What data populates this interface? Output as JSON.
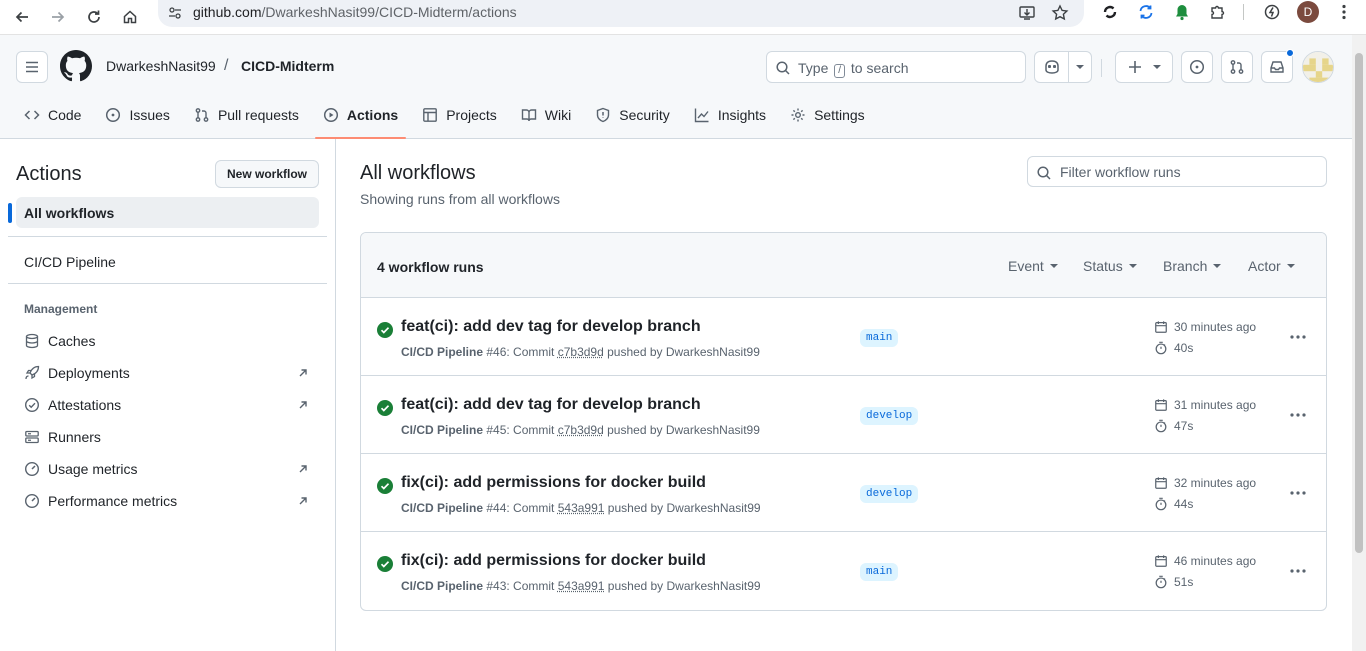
{
  "browser": {
    "url_host": "github.com",
    "url_path": "/DwarkeshNasit99/CICD-Midterm/actions",
    "profile_initial": "D"
  },
  "header": {
    "owner": "DwarkeshNasit99",
    "separator": "/",
    "repo": "CICD-Midterm",
    "search_pre": "Type",
    "search_key": "/",
    "search_post": "to search"
  },
  "tabs": [
    {
      "label": "Code",
      "icon": "code-icon"
    },
    {
      "label": "Issues",
      "icon": "issue-icon"
    },
    {
      "label": "Pull requests",
      "icon": "pull-request-icon"
    },
    {
      "label": "Actions",
      "icon": "play-icon",
      "active": true
    },
    {
      "label": "Projects",
      "icon": "table-icon"
    },
    {
      "label": "Wiki",
      "icon": "book-icon"
    },
    {
      "label": "Security",
      "icon": "shield-icon"
    },
    {
      "label": "Insights",
      "icon": "graph-icon"
    },
    {
      "label": "Settings",
      "icon": "gear-icon"
    }
  ],
  "sidebar": {
    "title": "Actions",
    "new_workflow": "New workflow",
    "all_workflows": "All workflows",
    "workflows": [
      "CI/CD Pipeline"
    ],
    "management_label": "Management",
    "management": [
      {
        "label": "Caches",
        "icon": "database-icon",
        "external": false
      },
      {
        "label": "Deployments",
        "icon": "rocket-icon",
        "external": true
      },
      {
        "label": "Attestations",
        "icon": "verified-icon",
        "external": true
      },
      {
        "label": "Runners",
        "icon": "server-icon",
        "external": false
      },
      {
        "label": "Usage metrics",
        "icon": "meter-icon",
        "external": true
      },
      {
        "label": "Performance metrics",
        "icon": "meter-icon",
        "external": true
      }
    ]
  },
  "main": {
    "title": "All workflows",
    "subtitle": "Showing runs from all workflows",
    "filter_placeholder": "Filter workflow runs",
    "runs_count": "4 workflow runs",
    "filters": [
      "Event",
      "Status",
      "Branch",
      "Actor"
    ],
    "runs": [
      {
        "title": "feat(ci): add dev tag for develop branch",
        "workflow": "CI/CD Pipeline",
        "number": "#46",
        "commit_label": ": Commit",
        "sha": "c7b3d9d",
        "pushed_by": "pushed by DwarkeshNasit99",
        "branch": "main",
        "when": "30 minutes ago",
        "duration": "40s",
        "status": "success"
      },
      {
        "title": "feat(ci): add dev tag for develop branch",
        "workflow": "CI/CD Pipeline",
        "number": "#45",
        "commit_label": ": Commit",
        "sha": "c7b3d9d",
        "pushed_by": "pushed by DwarkeshNasit99",
        "branch": "develop",
        "when": "31 minutes ago",
        "duration": "47s",
        "status": "success"
      },
      {
        "title": "fix(ci): add permissions for docker build",
        "workflow": "CI/CD Pipeline",
        "number": "#44",
        "commit_label": ": Commit",
        "sha": "543a991",
        "pushed_by": "pushed by DwarkeshNasit99",
        "branch": "develop",
        "when": "32 minutes ago",
        "duration": "44s",
        "status": "success"
      },
      {
        "title": "fix(ci): add permissions for docker build",
        "workflow": "CI/CD Pipeline",
        "number": "#43",
        "commit_label": ": Commit",
        "sha": "543a991",
        "pushed_by": "pushed by DwarkeshNasit99",
        "branch": "main",
        "when": "46 minutes ago",
        "duration": "51s",
        "status": "success"
      }
    ]
  },
  "colors": {
    "success": "#1a7f37",
    "accent": "#0969da",
    "active_tab_underline": "#fd8c73"
  }
}
